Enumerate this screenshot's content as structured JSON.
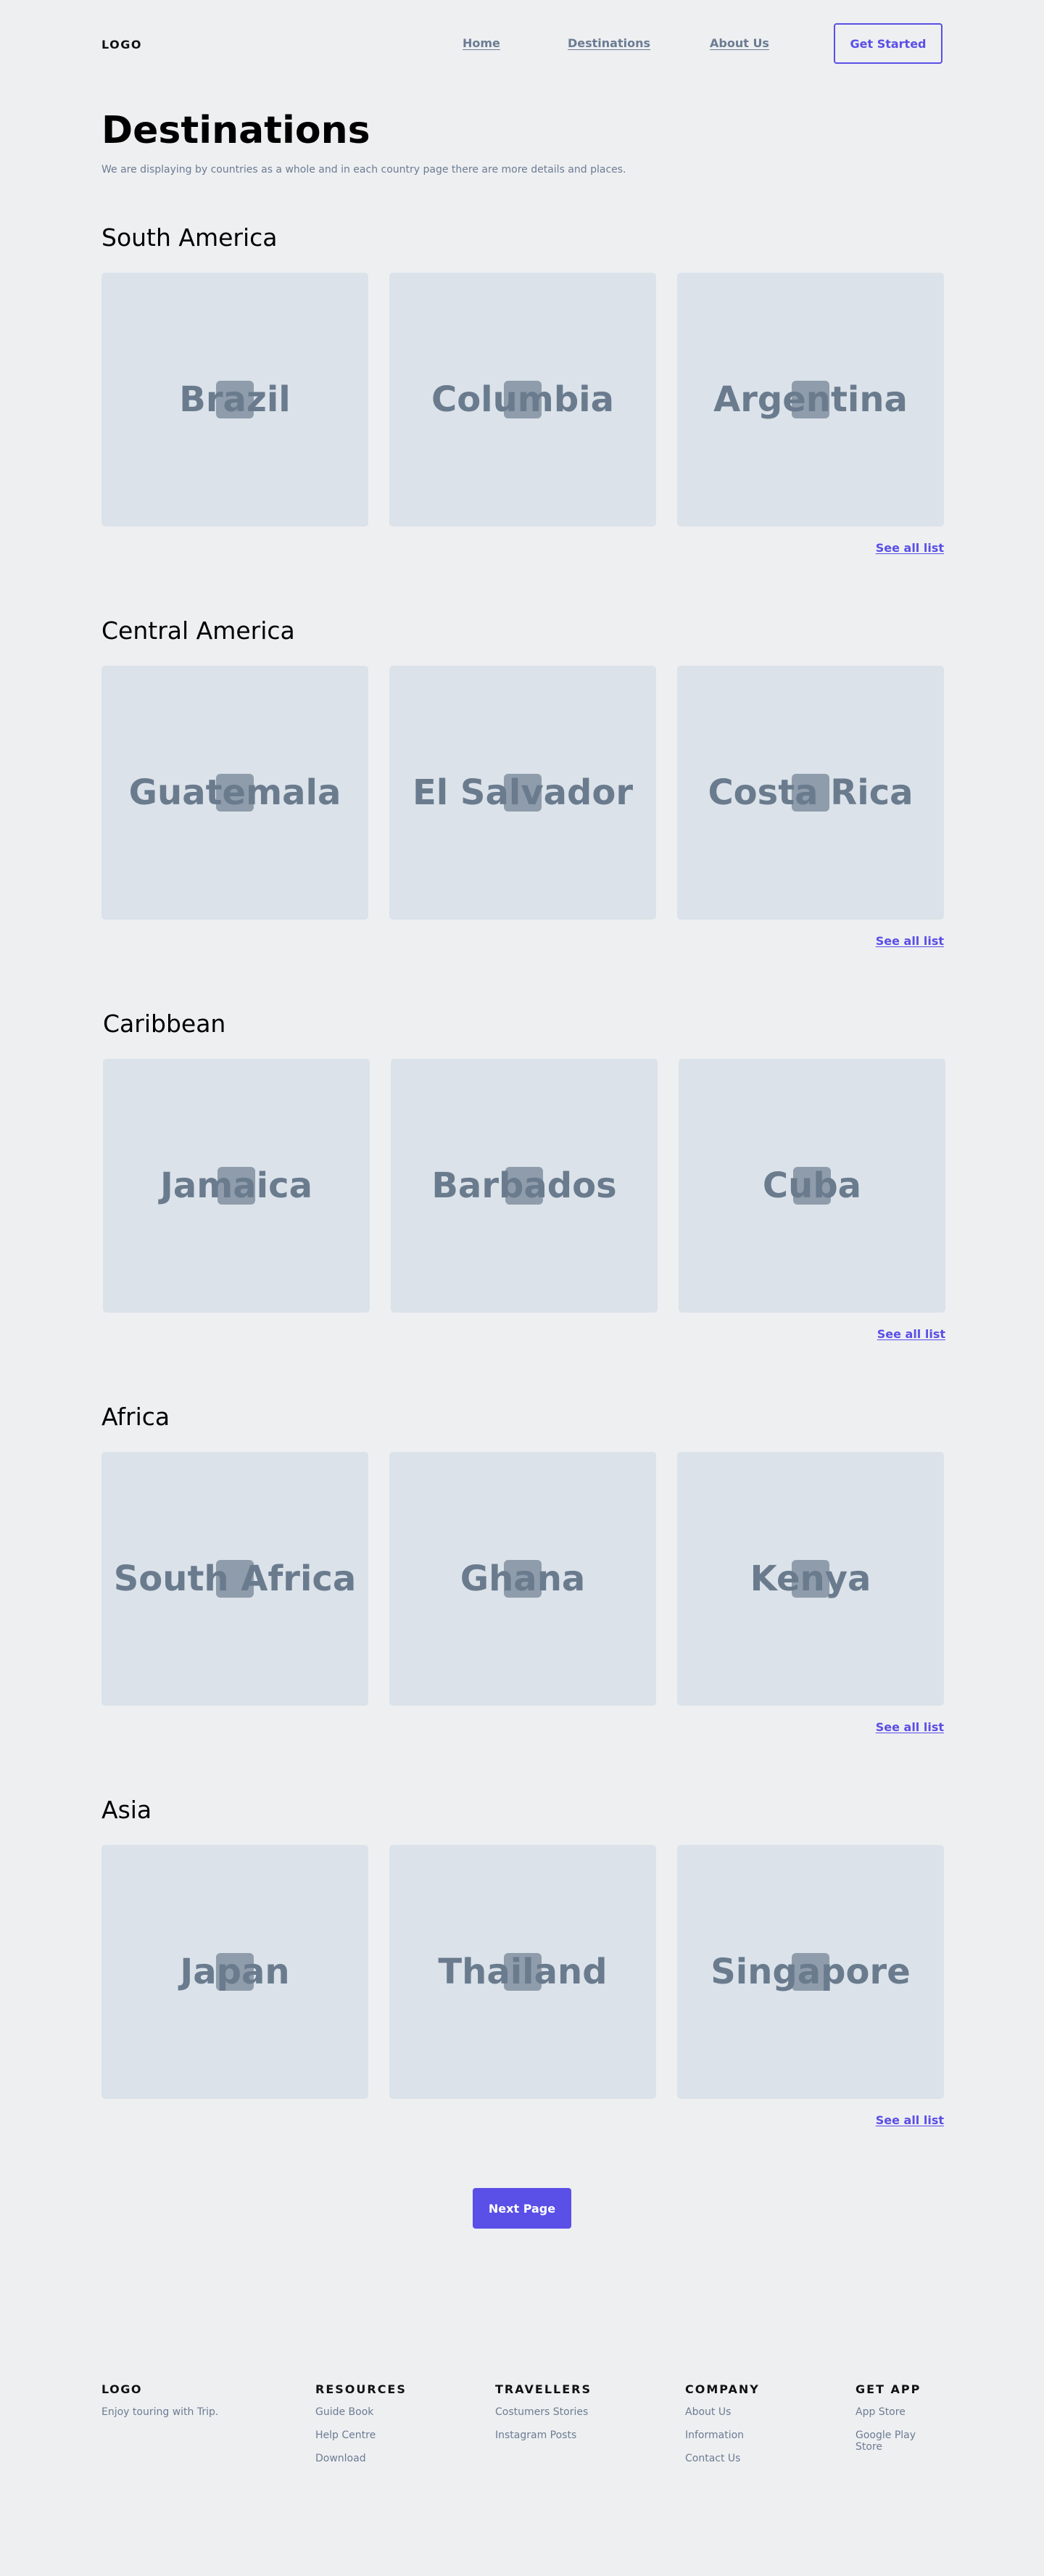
{
  "header": {
    "logo": "LOGO",
    "nav": [
      {
        "label": "Home"
      },
      {
        "label": "Destinations"
      },
      {
        "label": "About Us"
      }
    ],
    "cta_label": "Get Started"
  },
  "page": {
    "title": "Destinations",
    "subtitle": "We are displaying by countries as a whole and in each country page there are more details and places."
  },
  "regions": [
    {
      "title": "South America",
      "countries": [
        "Brazil",
        "Columbia",
        "Argentina"
      ],
      "see_all": "See all list"
    },
    {
      "title": "Central America",
      "countries": [
        "Guatemala",
        "El Salvador",
        "Costa Rica"
      ],
      "see_all": "See all list"
    },
    {
      "title": "Caribbean",
      "countries": [
        "Jamaica",
        "Barbados",
        "Cuba"
      ],
      "see_all": "See all list"
    },
    {
      "title": "Africa",
      "countries": [
        "South Africa",
        "Ghana",
        "Kenya"
      ],
      "see_all": "See all list"
    },
    {
      "title": "Asia",
      "countries": [
        "Japan",
        "Thailand",
        "Singapore"
      ],
      "see_all": "See all list"
    }
  ],
  "pagination": {
    "next_label": "Next Page"
  },
  "footer": {
    "logo": "LOGO",
    "tagline": "Enjoy touring with Trip.",
    "columns": [
      {
        "heading": "RESOURCES",
        "links": [
          "Guide Book",
          "Help Centre",
          "Download"
        ]
      },
      {
        "heading": "TRAVELLERS",
        "links": [
          "Costumers Stories",
          "Instagram Posts"
        ]
      },
      {
        "heading": "COMPANY",
        "links": [
          "About Us",
          "Information",
          "Contact Us"
        ]
      },
      {
        "heading": "GET APP",
        "links": [
          "App Store",
          "Google Play Store"
        ]
      }
    ]
  },
  "colors": {
    "background": "#eeeff1",
    "accent": "#5a4fe6",
    "card": "#dbe2e9",
    "muted_text": "#6b7c93"
  }
}
